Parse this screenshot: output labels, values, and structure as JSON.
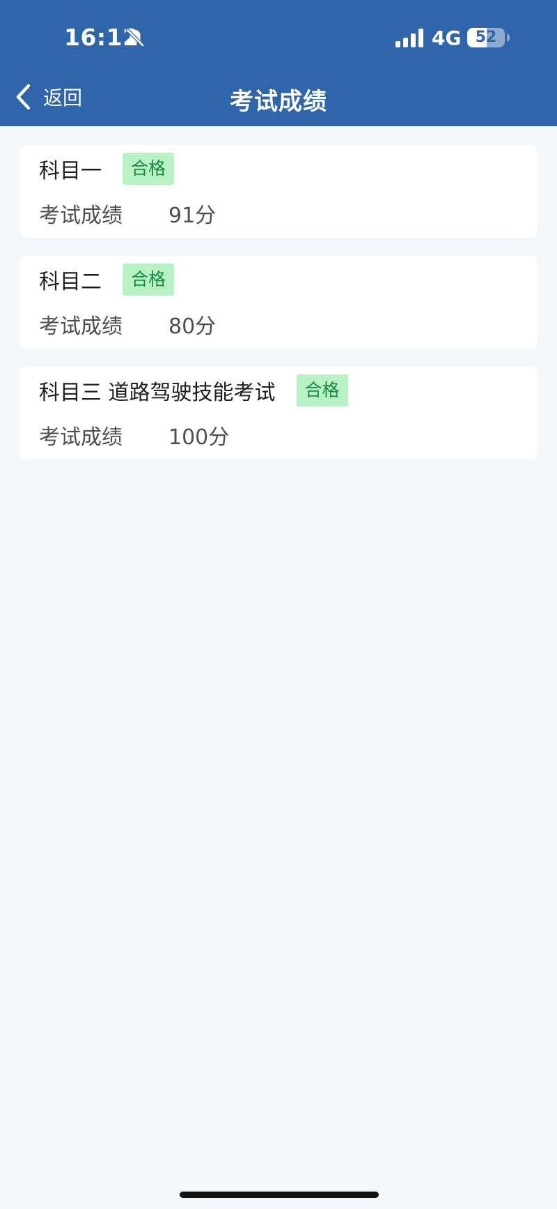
{
  "status_bar": {
    "time": "16:12",
    "network": "4G",
    "battery": "52",
    "battery_level": 0.52,
    "icons": [
      "bell-slash-icon",
      "signal-icon",
      "battery-icon"
    ]
  },
  "nav": {
    "back_label": "返回",
    "title": "考试成绩",
    "back_icon": "chevron-left-icon"
  },
  "results": [
    {
      "subject": "科目一",
      "status": "合格",
      "score_label": "考试成绩",
      "score": "91分"
    },
    {
      "subject": "科目二",
      "status": "合格",
      "score_label": "考试成绩",
      "score": "80分"
    },
    {
      "subject": "科目三 道路驾驶技能考试",
      "status": "合格",
      "score_label": "考试成绩",
      "score": "100分"
    }
  ],
  "colors": {
    "header": "#2f66ab",
    "page_background": "#f3f7f9",
    "badge_background": "#b8f2c4",
    "badge_text": "#178b43"
  }
}
